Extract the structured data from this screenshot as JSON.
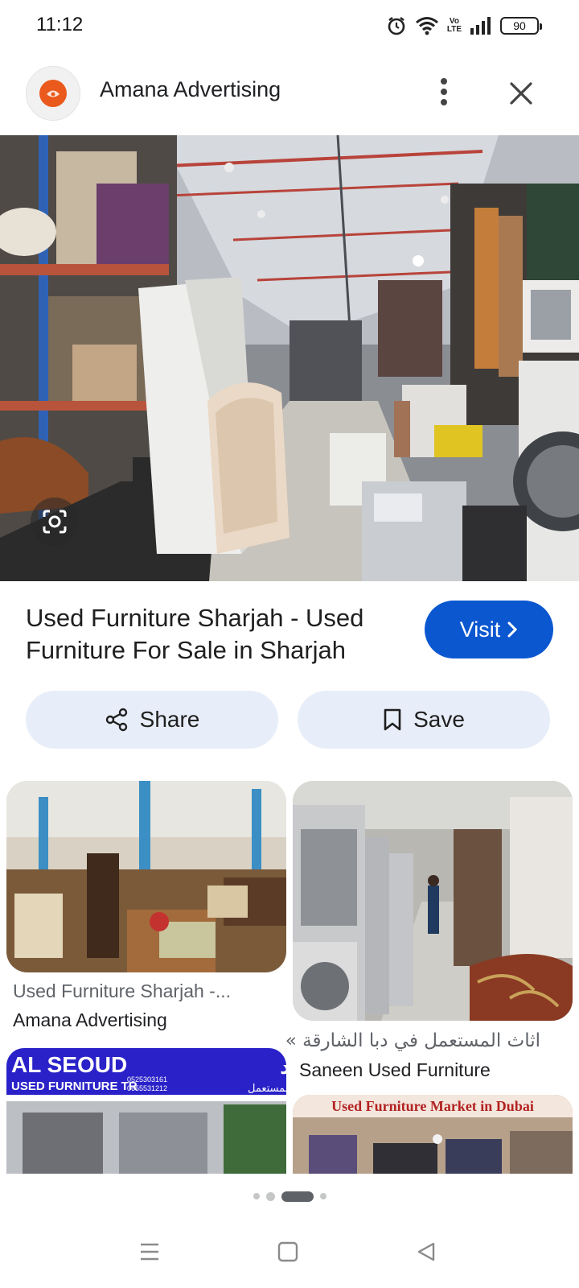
{
  "status_bar": {
    "time": "11:12",
    "volte": "Vo LTE",
    "battery": "90",
    "icons": [
      "alarm-icon",
      "wifi-icon",
      "volte-icon",
      "signal-icon",
      "battery-icon"
    ]
  },
  "header": {
    "site_name": "Amana Advertising",
    "more_icon": "more-vert-icon",
    "close_icon": "close-icon"
  },
  "result": {
    "title": "Used Furniture Sharjah - Used Furniture For Sale in Sharjah",
    "visit_label": "Visit",
    "share_label": "Share",
    "save_label": "Save"
  },
  "related": [
    {
      "caption": "Used Furniture Sharjah -...",
      "source": "Amana Advertising"
    },
    {
      "caption": "اثاث المستعمل في دبا الشارقة »",
      "source": "Saneen Used Furniture"
    },
    {
      "sign_title": "AL SEOUD",
      "sign_subtitle": "USED FURNITURE TR",
      "sign_arabic": "السعود",
      "sign_arabic_sub": "اثاث المستعمل",
      "sign_phone_1": "0525303161",
      "sign_phone_2": "0655531212"
    },
    {
      "banner": "Used Furniture Market in Dubai"
    }
  ],
  "pager": {
    "pages": 4,
    "active": 2
  },
  "colors": {
    "accent": "#0b57d0",
    "pill_bg": "#e8eef9",
    "logo": "#ea5a1c"
  }
}
